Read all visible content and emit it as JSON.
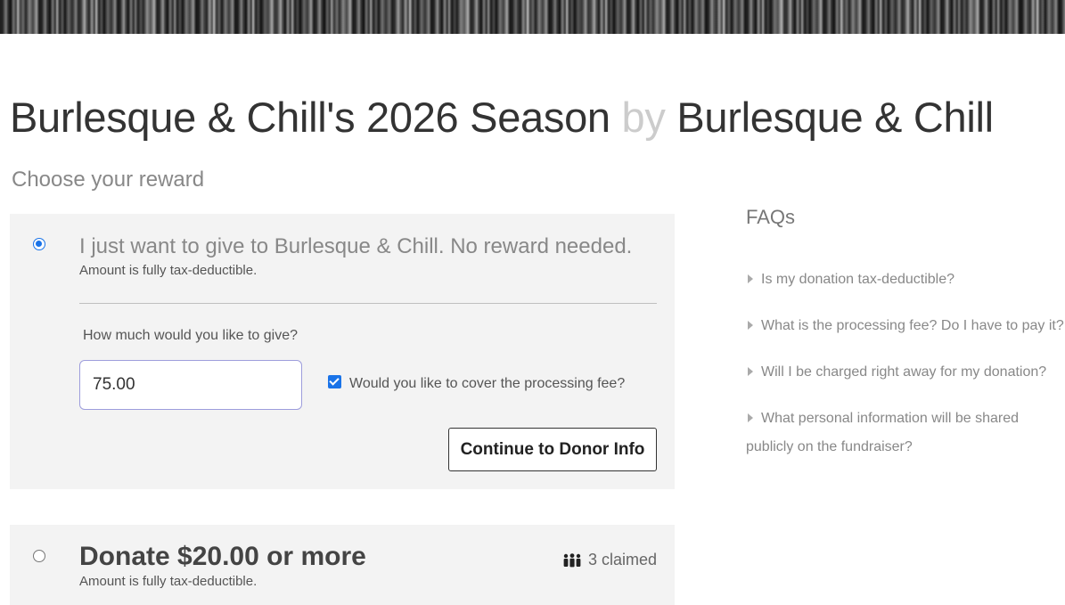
{
  "header": {
    "title_main": "Burlesque & Chill's 2026 Season",
    "title_by": "by",
    "title_org": "Burlesque & Chill"
  },
  "reward_section": {
    "heading": "Choose your reward"
  },
  "reward_options": [
    {
      "selected": true,
      "title": "I just want to give to Burlesque & Chill. No reward needed.",
      "tax_note": "Amount is fully tax-deductible.",
      "amount_question": "How much would you like to give?",
      "amount_value": "75.00",
      "cover_fee_checked": true,
      "cover_fee_label": "Would you like to cover the processing fee?",
      "continue_label": "Continue to Donor Info"
    },
    {
      "selected": false,
      "title": "Donate $20.00 or more",
      "tax_note": "Amount is fully tax-deductible.",
      "claimed": "3 claimed",
      "claimed_icon": "people-icon"
    }
  ],
  "faqs": {
    "heading": "FAQs",
    "items": [
      "Is my donation tax-deductible?",
      "What is the processing fee? Do I have to pay it?",
      "Will I be charged right away for my donation?",
      "What personal information will be shared publicly on the fundraiser?"
    ]
  },
  "colors": {
    "accent": "#1a73e8",
    "card_bg": "#f3f3f3",
    "muted_text": "#888888"
  }
}
